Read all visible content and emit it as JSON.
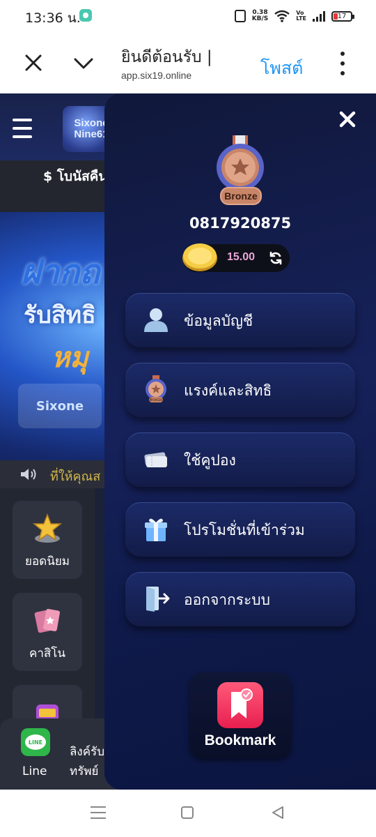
{
  "status_bar": {
    "time": "13:36 น.",
    "network_speed_value": "0.38",
    "network_speed_unit": "KB/S",
    "volte_line1": "Vo",
    "volte_line2": "LTE",
    "battery_level": "17"
  },
  "browser": {
    "page_title": "ยินดีต้อนรับ |",
    "url": "app.six19.online",
    "post_label": "โพสต์"
  },
  "site": {
    "logo_line1": "Sixone",
    "logo_line2": "Nine61",
    "bonus_text": "$ โบนัสคืน",
    "banner_line1": "ฝากถ",
    "banner_line2": "รับสิทธิ",
    "banner_line3": "หมุ",
    "banner_logo": "Sixone",
    "marquee_text": "ที่ให้คุณส",
    "categories": [
      {
        "label": "ยอดนิยม",
        "icon": "star-icon"
      },
      {
        "label": "คาสิโน",
        "icon": "cards-icon"
      },
      {
        "label": "",
        "icon": "slot-machine-icon"
      }
    ],
    "line_icon_text": "LINE",
    "line_label": "Line",
    "strip_line1": "ลิงค์รับ",
    "strip_line2": "ทรัพย์"
  },
  "drawer": {
    "rank_badge": "Bronze",
    "username": "0817920875",
    "balance": "15.00",
    "menu": [
      {
        "label": "ข้อมูลบัญชี",
        "icon": "user-icon"
      },
      {
        "label": "แรงค์และสิทธิ",
        "icon": "rank-medal-icon",
        "icon_caption": "Bronze"
      },
      {
        "label": "ใช้คูปอง",
        "icon": "coupon-icon"
      },
      {
        "label": "โปรโมชั่นที่เข้าร่วม",
        "icon": "gift-icon"
      },
      {
        "label": "ออกจากระบบ",
        "icon": "logout-icon"
      }
    ],
    "bookmark_label": "Bookmark"
  },
  "colors": {
    "accent_blue": "#2196f3",
    "drawer_bg": "#16215a",
    "balance_text": "#e9a7d8",
    "line_green": "#2fb64a",
    "bookmark_red": "#e81f4f",
    "bronze": "#c98567"
  }
}
